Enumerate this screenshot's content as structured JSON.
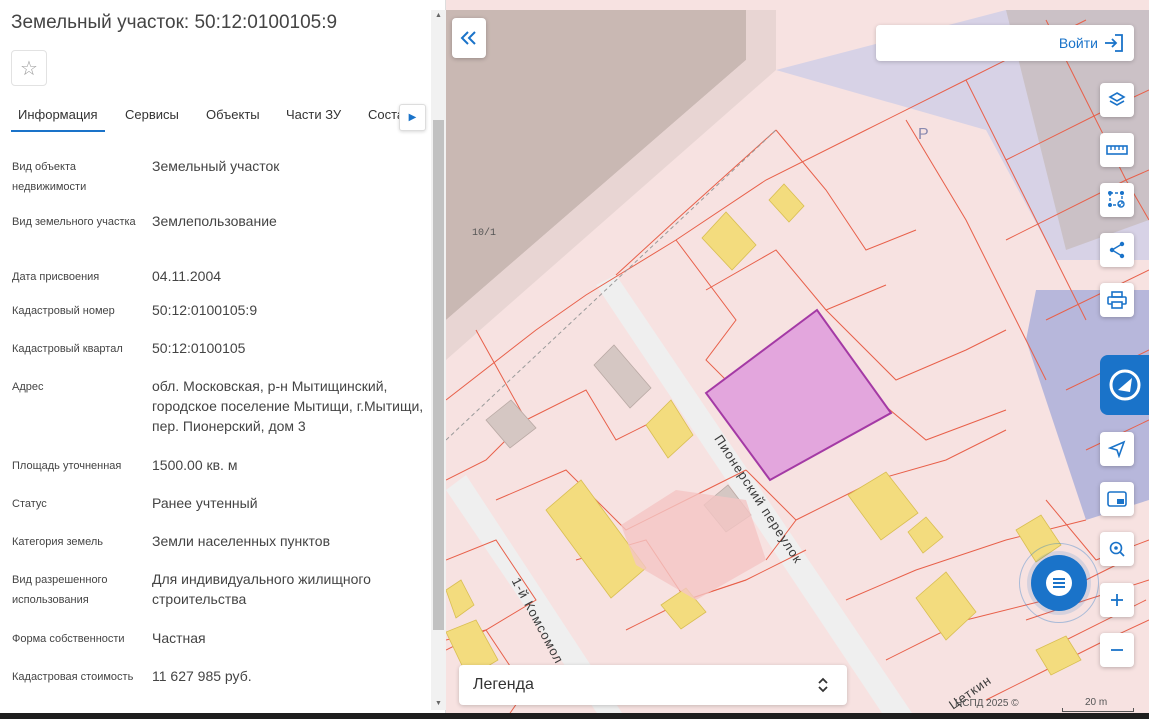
{
  "panel": {
    "title": "Земельный участок: 50:12:0100105:9",
    "favorite_icon": "star-icon",
    "tabs": [
      {
        "label": "Информация"
      },
      {
        "label": "Сервисы"
      },
      {
        "label": "Объекты"
      },
      {
        "label": "Части ЗУ"
      },
      {
        "label": "Состав"
      }
    ],
    "info": [
      {
        "label": "Вид объекта недвижимости",
        "value": "Земельный участок"
      },
      {
        "label": "Вид земельного участка",
        "value": "Землепользование"
      },
      {
        "label": "Дата присвоения",
        "value": "04.11.2004"
      },
      {
        "label": "Кадастровый номер",
        "value": "50:12:0100105:9"
      },
      {
        "label": "Кадастровый квартал",
        "value": "50:12:0100105"
      },
      {
        "label": "Адрес",
        "value": "обл. Московская, р-н Мытищинский, городское поселение Мытищи, г.Мытищи, пер. Пионерский, дом 3"
      },
      {
        "label": "Площадь уточненная",
        "value": "1500.00 кв. м"
      },
      {
        "label": "Статус",
        "value": "Ранее учтенный"
      },
      {
        "label": "Категория земель",
        "value": "Земли населенных пунктов"
      },
      {
        "label": "Вид разрешенного использования",
        "value": "Для индивидуального жилищного строительства"
      },
      {
        "label": "Форма собственности",
        "value": "Частная"
      },
      {
        "label": "Кадастровая стоимость",
        "value": "11 627 985 руб."
      }
    ]
  },
  "map": {
    "login_label": "Войти",
    "legend_label": "Легенда",
    "copyright": "НСПД 2025 ©",
    "scale_label": "20 m",
    "labels": {
      "street_1": "Пионерский  переулок",
      "street_2": "1-й  Комсомол",
      "street_3": "Цеткин",
      "block_label": "10/1",
      "parking": "P"
    },
    "toolbar_icons": [
      "layers-icon",
      "ruler-icon",
      "select-area-icon",
      "share-icon",
      "print-icon",
      "locate-icon",
      "minimap-icon",
      "search-location-icon",
      "zoom-in-icon",
      "zoom-out-icon"
    ],
    "colors": {
      "accent": "#1a73c9",
      "selected_parcel": "#e3a6dd",
      "parcel_border": "#e8604a",
      "building": "#f3dc7e"
    }
  }
}
